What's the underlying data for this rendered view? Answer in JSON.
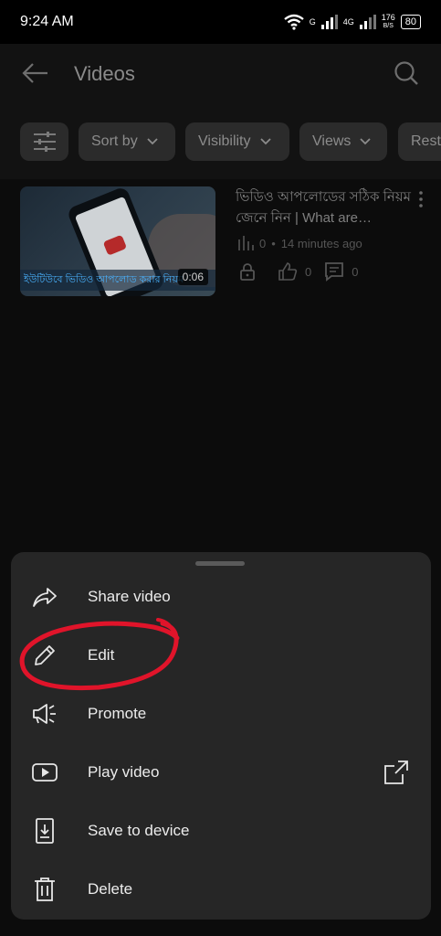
{
  "status_bar": {
    "time": "9:24 AM",
    "network1": "G",
    "network2": "4G",
    "speed": "176",
    "speed_unit": "B/S",
    "battery": "80"
  },
  "header": {
    "title": "Videos"
  },
  "filters": [
    {
      "label": "Sort by"
    },
    {
      "label": "Visibility"
    },
    {
      "label": "Views"
    },
    {
      "label": "Rest"
    }
  ],
  "video": {
    "title": "ভিডিও আপলোডের সঠিক নিয়ম জেনে নিন | What are…",
    "thumb_caption": "ইউটিউবে ভিডিও আপলোড করার নিয়ম",
    "duration": "0:06",
    "views": "0",
    "age": "14 minutes ago",
    "likes": "0",
    "comments": "0"
  },
  "menu": {
    "items": [
      {
        "label": "Share video",
        "icon": "share-icon"
      },
      {
        "label": "Edit",
        "icon": "pencil-icon"
      },
      {
        "label": "Promote",
        "icon": "megaphone-icon"
      },
      {
        "label": "Play video",
        "icon": "play-icon"
      },
      {
        "label": "Save to device",
        "icon": "download-icon"
      },
      {
        "label": "Delete",
        "icon": "trash-icon"
      }
    ]
  },
  "colors": {
    "annotation": "#e0142a",
    "accent": "#4ab3ff"
  }
}
